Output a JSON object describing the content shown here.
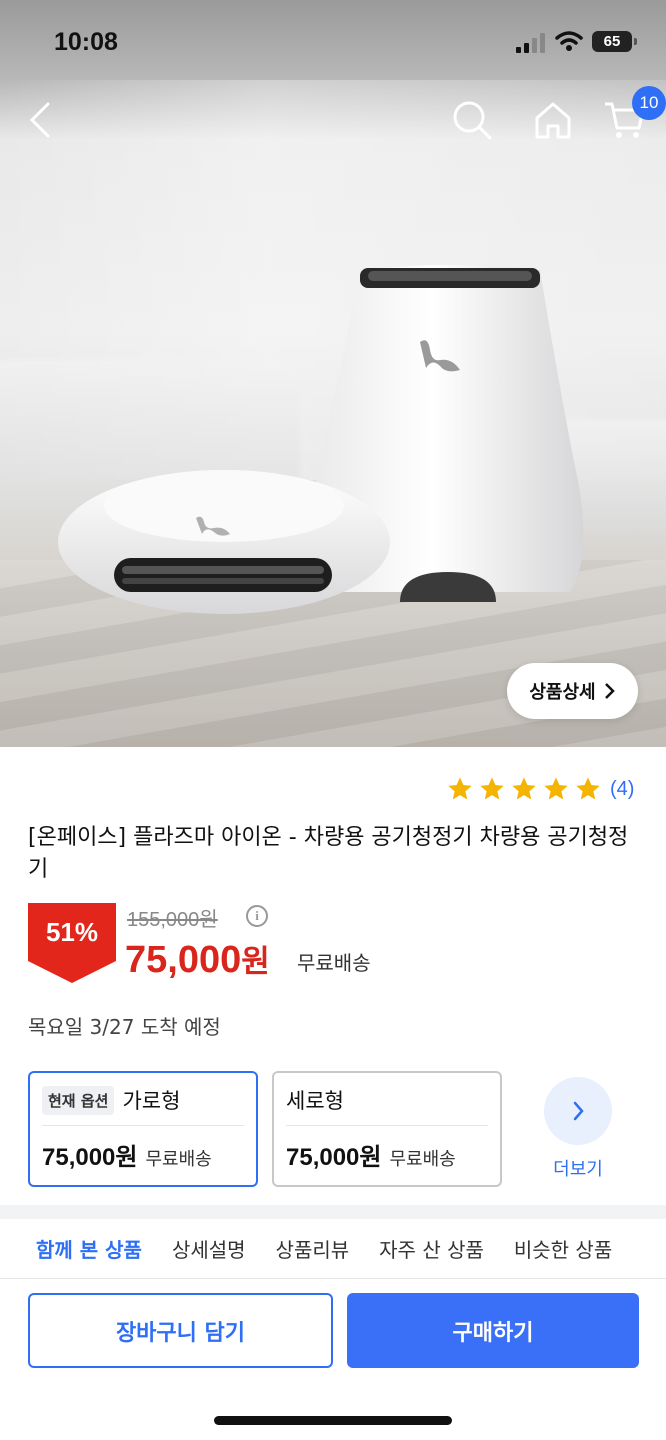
{
  "status_bar": {
    "time": "10:08",
    "battery": "65"
  },
  "header": {
    "cart_count": "10",
    "icons": [
      "back-icon",
      "search-icon",
      "home-icon",
      "cart-icon"
    ]
  },
  "hero": {
    "detail_button_label": "상품상세"
  },
  "product": {
    "rating_count": "(4)",
    "rating_stars": 5,
    "title": "[온페이스] 플라즈마 아이온 - 차량용 공기청정기 차량용 공기청정기",
    "discount": "51%",
    "original_price": "155,000원",
    "price": "75,000",
    "price_unit": "원",
    "shipping": "무료배송",
    "delivery": "목요일 3/27 도착 예정"
  },
  "options": {
    "current_chip": "현재 옵션",
    "items": [
      {
        "name": "가로형",
        "price": "75,000원",
        "shipping": "무료배송",
        "selected": true
      },
      {
        "name": "세로형",
        "price": "75,000원",
        "shipping": "무료배송",
        "selected": false
      }
    ],
    "more_label": "더보기"
  },
  "tabs": [
    "함께 본 상품",
    "상세설명",
    "상품리뷰",
    "자주 산 상품",
    "비슷한 상품"
  ],
  "actions": {
    "add_to_cart": "장바구니 담기",
    "buy": "구매하기"
  },
  "colors": {
    "accent": "#2e6ff5",
    "price_red": "#d8261c",
    "star": "#f5b400"
  }
}
